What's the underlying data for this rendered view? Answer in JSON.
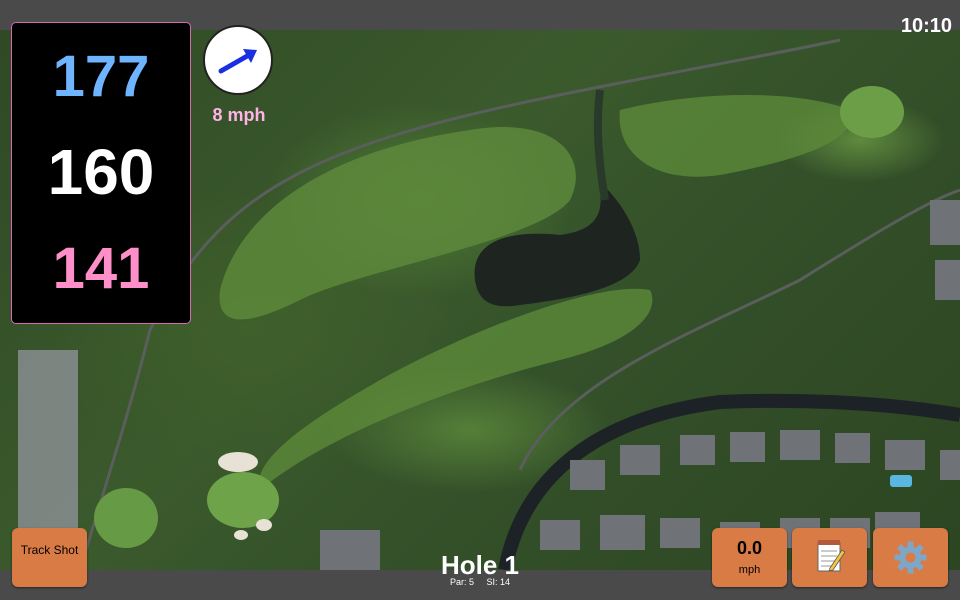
{
  "status_bar": {
    "time": "10:10"
  },
  "yardage": {
    "back": "177",
    "middle": "160",
    "front": "141"
  },
  "wind": {
    "speed_label": "8 mph",
    "direction_icon": "arrow-right-icon"
  },
  "hole": {
    "title": "Hole 1",
    "par_label": "Par: 5",
    "si_label": "SI: 14"
  },
  "buttons": {
    "track_shot": "Track Shot",
    "wind_readout_value": "0.0",
    "wind_readout_unit": "mph",
    "notes_icon": "notepad-icon",
    "settings_icon": "gear-icon"
  },
  "colors": {
    "back": "#6eb4ff",
    "middle": "#ffffff",
    "front": "#ff8fc8",
    "button": "#d97b44",
    "wind_label": "#ffb3e6"
  }
}
